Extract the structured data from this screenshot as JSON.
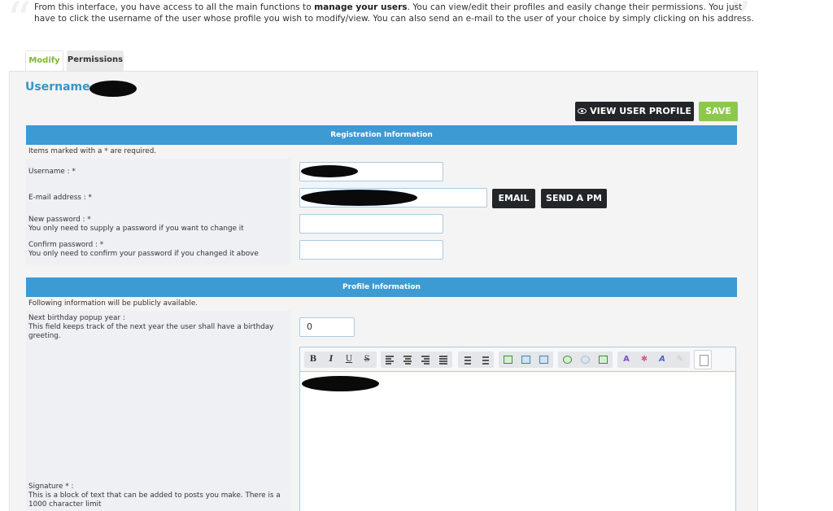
{
  "intro": {
    "part1": "From this interface, you have access to all the main functions to ",
    "bold": "manage your users",
    "part2": ". You can view/edit their profiles and easily change their permissions. You just have to click the username of the user whose profile you wish to modify/view. You can also send an e-mail to the user of your choice by simply clicking on his address."
  },
  "tabs": [
    {
      "label": "Modify",
      "active": true
    },
    {
      "label": "Permissions",
      "active": false
    }
  ],
  "header": {
    "username_label": "Username :"
  },
  "actions": {
    "view_profile": "VIEW USER PROFILE",
    "save": "SAVE"
  },
  "registration": {
    "title": "Registration Information",
    "required_note": "Items marked with a * are required.",
    "username_label": "Username : *",
    "email_label": "E-mail address : *",
    "email_button": "EMAIL",
    "pm_button": "SEND A PM",
    "new_password_label": "New password : *",
    "new_password_help": "You only need to supply a password if you want to change it",
    "confirm_password_label": "Confirm password : *",
    "confirm_password_help": "You only need to confirm your password if you changed it above"
  },
  "profile": {
    "title": "Profile Information",
    "public_note": "Following information will be publicly available.",
    "birthday_label": "Next birthday popup year :",
    "birthday_help": "This field keeps track of the next year the user shall have a birthday greeting.",
    "birthday_value": "0",
    "signature_label": "Signature * :",
    "signature_help": "This is a block of text that can be added to posts you make. There is a 1000 character limit"
  },
  "editor_toolbar": {
    "bold": "B",
    "italic": "I",
    "underline": "U",
    "strike": "S"
  },
  "colors": {
    "accent_blue": "#3e9ad2",
    "title_blue": "#3a93c5",
    "save_green": "#8cc94b",
    "tab_active_green": "#7cb928",
    "dark_button": "#222628"
  }
}
